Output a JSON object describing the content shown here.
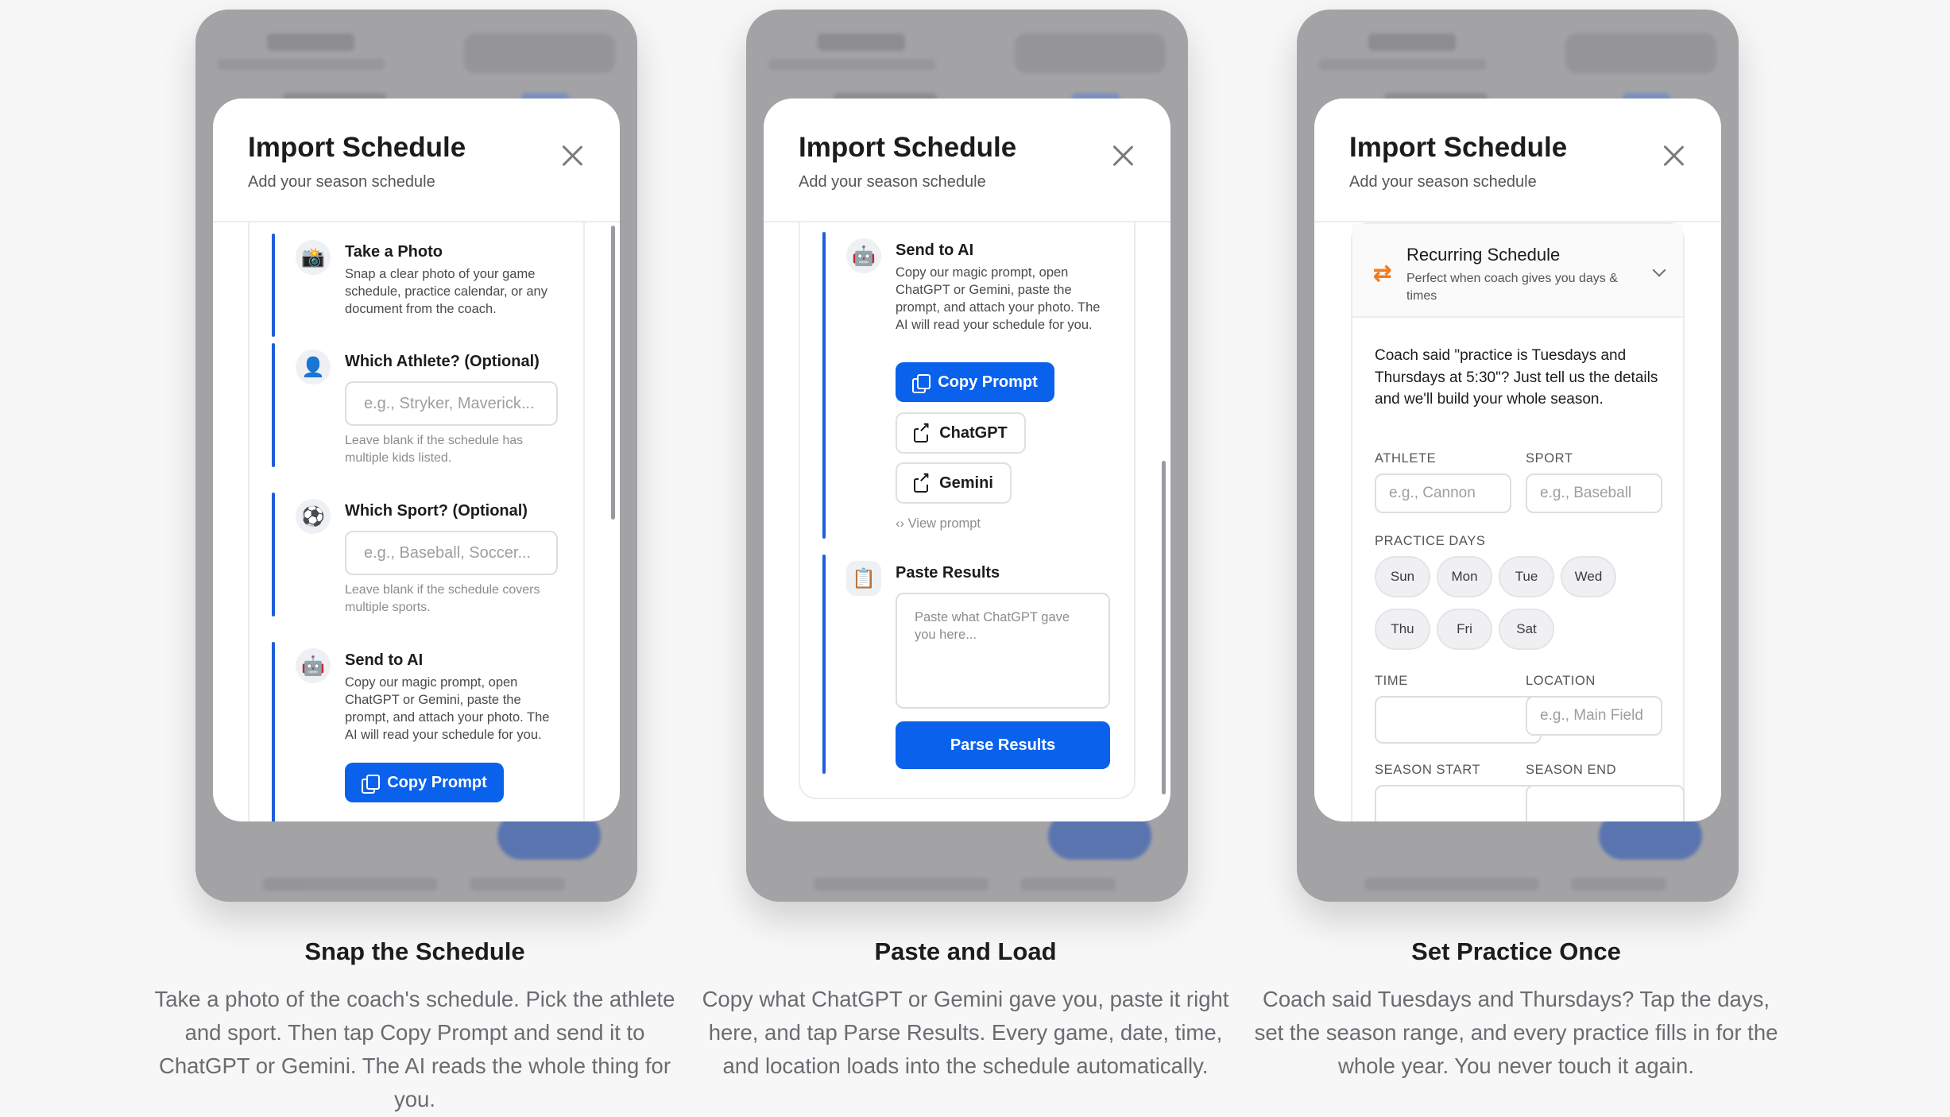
{
  "modal": {
    "title": "Import Schedule",
    "subtitle": "Add your season schedule"
  },
  "steps": {
    "photo": {
      "title": "Take a Photo",
      "description": "Snap a clear photo of your game schedule, practice calendar, or any document from the coach."
    },
    "athlete": {
      "title": "Which Athlete? (Optional)",
      "placeholder": "e.g., Stryker, Maverick...",
      "hint": "Leave blank if the schedule has multiple kids listed."
    },
    "sport": {
      "title": "Which Sport? (Optional)",
      "placeholder": "e.g., Baseball, Soccer...",
      "hint": "Leave blank if the schedule covers multiple sports."
    },
    "send": {
      "title": "Send to AI",
      "description": "Copy our magic prompt, open ChatGPT or Gemini, paste the prompt, and attach your photo. The AI will read your schedule for you.",
      "copy_button": "Copy Prompt",
      "chatgpt_button": "ChatGPT",
      "gemini_button": "Gemini",
      "view_prompt": "View prompt"
    },
    "paste": {
      "title": "Paste Results",
      "placeholder": "Paste what ChatGPT gave you here...",
      "parse_button": "Parse Results"
    }
  },
  "recurring": {
    "title": "Recurring Schedule",
    "subtitle": "Perfect when coach gives you days & times",
    "description": "Coach said \"practice is Tuesdays and Thursdays at 5:30\"? Just tell us the details and we'll build your whole season.",
    "athlete_label": "ATHLETE",
    "athlete_placeholder": "e.g., Cannon",
    "sport_label": "SPORT",
    "sport_placeholder": "e.g., Baseball",
    "days_label": "PRACTICE DAYS",
    "days": [
      "Sun",
      "Mon",
      "Tue",
      "Wed",
      "Thu",
      "Fri",
      "Sat"
    ],
    "time_label": "TIME",
    "location_label": "LOCATION",
    "location_placeholder": "e.g., Main Field",
    "season_start_label": "SEASON START",
    "season_end_label": "SEASON END"
  },
  "captions": [
    {
      "title": "Snap the Schedule",
      "text": "Take a photo of the coach's schedule. Pick the athlete and sport. Then tap Copy Prompt and send it to ChatGPT or Gemini. The AI reads the whole thing for you."
    },
    {
      "title": "Paste and Load",
      "text": "Copy what ChatGPT or Gemini gave you, paste it right here, and tap Parse Results. Every game, date, time, and location loads into the schedule automatically."
    },
    {
      "title": "Set Practice Once",
      "text": "Coach said Tuesdays and Thursdays? Tap the days, set the season range, and every practice fills in for the whole year. You never touch it again."
    }
  ],
  "icons": {
    "photo": "camera-icon",
    "athlete": "person-icon",
    "sport": "soccer-ball-icon",
    "send": "robot-icon",
    "paste": "clipboard-icon",
    "recurring": "repeat-icon"
  },
  "colors": {
    "accent": "#0a61ec",
    "rail": "#1f5fd8",
    "recurring_icon": "#f37b1d"
  }
}
